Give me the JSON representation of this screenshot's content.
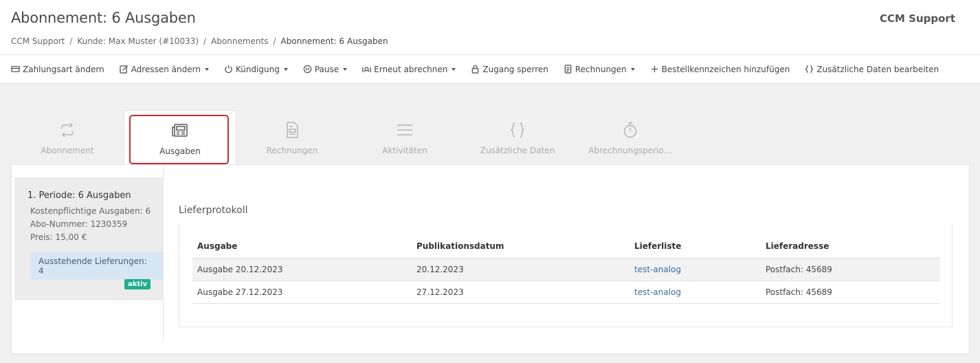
{
  "header": {
    "title": "Abonnement: 6 Ausgaben",
    "user": "CCM Support"
  },
  "breadcrumb": [
    {
      "label": "CCM Support"
    },
    {
      "label": "Kunde: Max Muster (#10033)"
    },
    {
      "label": "Abonnements"
    },
    {
      "label": "Abonnement: 6 Ausgaben"
    }
  ],
  "breadcrumb_separator": "/",
  "toolbar": [
    {
      "label": "Zahlungsart ändern",
      "icon": "credit-card-icon",
      "dropdown": false
    },
    {
      "label": "Adressen ändern",
      "icon": "edit-icon",
      "dropdown": true
    },
    {
      "label": "Kündigung",
      "icon": "power-icon",
      "dropdown": true
    },
    {
      "label": "Pause",
      "icon": "pause-icon",
      "dropdown": true
    },
    {
      "label": "Erneut abrechnen",
      "icon": "money-hand-icon",
      "dropdown": true
    },
    {
      "label": "Zugang sperren",
      "icon": "lock-icon",
      "dropdown": false
    },
    {
      "label": "Rechnungen",
      "icon": "invoice-icon",
      "dropdown": true
    },
    {
      "label": "Bestellkennzeichen hinzufügen",
      "icon": "plus-icon",
      "dropdown": false
    },
    {
      "label": "Zusätzliche Daten bearbeiten",
      "icon": "braces-icon",
      "dropdown": false
    }
  ],
  "tabs": [
    {
      "label": "Abonnement",
      "icon": "repeat-icon",
      "active": false
    },
    {
      "label": "Ausgaben",
      "icon": "newspaper-icon",
      "active": true
    },
    {
      "label": "Rechnungen",
      "icon": "invoice-icon",
      "active": false
    },
    {
      "label": "Aktivitäten",
      "icon": "list-icon",
      "active": false
    },
    {
      "label": "Zusätzliche Daten",
      "icon": "braces-icon",
      "active": false
    },
    {
      "label": "Abrechnungsperio…",
      "icon": "stopwatch-icon",
      "active": false
    }
  ],
  "period": {
    "title": "1. Periode: 6 Ausgaben",
    "paid_issues": "Kostenpflichtige Ausgaben: 6",
    "subscription_number": "Abo-Nummer: 1230359",
    "price": "Preis: 15,00 €",
    "pending": "Ausstehende Lieferungen: 4",
    "status": "aktiv"
  },
  "delivery_log": {
    "title": "Lieferprotokoll",
    "columns": [
      "Ausgabe",
      "Publikationsdatum",
      "Lieferliste",
      "Lieferadresse"
    ],
    "rows": [
      [
        "Ausgabe 20.12.2023",
        "20.12.2023",
        "test-analog",
        "Postfach: 45689"
      ],
      [
        "Ausgabe 27.12.2023",
        "27.12.2023",
        "test-analog",
        "Postfach: 45689"
      ]
    ]
  },
  "colors": {
    "accent_highlight": "#d9262c",
    "status_green": "#1fae8b",
    "link_blue": "#3a6ea5",
    "badge_blue": "#d8e6f4"
  }
}
